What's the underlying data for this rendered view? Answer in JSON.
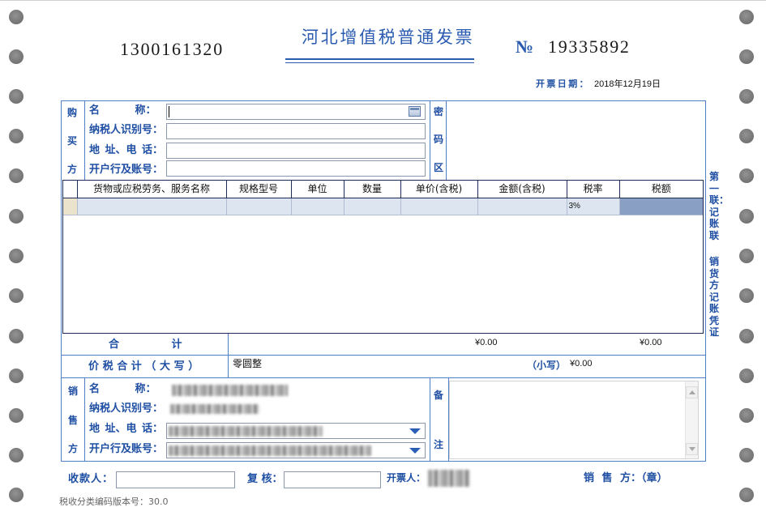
{
  "invoice": {
    "code": "1300161320",
    "title": "河北增值税普通发票",
    "number_symbol": "№",
    "number": "19335892",
    "date_label": "开票日期：",
    "date": "2018年12月19日"
  },
  "buyer": {
    "section_label": [
      "购",
      "买",
      "方"
    ],
    "name_label": "名 称：",
    "tax_id_label": "纳税人识别号：",
    "address_phone_label": "地 址、电 话：",
    "bank_account_label": "开户行及账号："
  },
  "cipher_area_label": [
    "密",
    "码",
    "区"
  ],
  "items": {
    "headers": [
      "货物或应税劳务、服务名称",
      "规格型号",
      "单位",
      "数量",
      "单价(含税)",
      "金额(含税)",
      "税率",
      "税额"
    ],
    "rows": [
      {
        "name": "",
        "spec": "",
        "unit": "",
        "quantity": "",
        "unit_price": "",
        "amount": "",
        "tax_rate": "3%",
        "tax": ""
      }
    ]
  },
  "totals": {
    "label": "合 计",
    "amount": "¥0.00",
    "tax": "¥0.00"
  },
  "grand_total": {
    "label": "价税合计（大写）",
    "in_words": "零圆整",
    "figures_label": "（小写）",
    "in_figures": "¥0.00"
  },
  "seller": {
    "section_label": [
      "销",
      "售",
      "方"
    ],
    "name_label": "名 称：",
    "tax_id_label": "纳税人识别号：",
    "address_phone_label": "地 址、电 话：",
    "bank_account_label": "开户行及账号："
  },
  "remarks_label": [
    "备",
    "注"
  ],
  "footer": {
    "payee_label": "收款人：",
    "reviewer_label": "复 核：",
    "issuer_label": "开票人：",
    "seller_seal_label": "销 售 方：（章）",
    "version": "税收分类编码版本号：30.0"
  },
  "side_note": {
    "part1": "第一联：记账联",
    "part2": "销货方记账凭证"
  },
  "colors": {
    "label_blue": "#1f4fa3",
    "title_blue": "#2a5bb0",
    "form_border": "#4f80c8",
    "table_border": "#1d2b57",
    "row_fill": "#dce5f0",
    "row_marker": "#ece3cc",
    "tax_cell_fill": "#8a9fc4",
    "perforation": "#777777"
  }
}
